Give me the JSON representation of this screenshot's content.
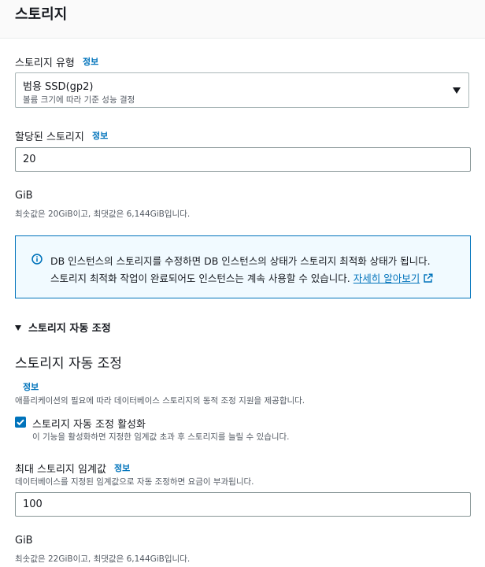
{
  "header": {
    "title": "스토리지"
  },
  "storage_type": {
    "label": "스토리지 유형",
    "info": "정보",
    "selected_value": "범용 SSD(gp2)",
    "selected_description": "볼륨 크기에 따라 기준 성능 결정"
  },
  "allocated_storage": {
    "label": "할당된 스토리지",
    "info": "정보",
    "value": "20",
    "unit": "GiB",
    "constraint": "최솟값은 20GiB이고, 최댓값은 6,144GiB입니다."
  },
  "alert": {
    "line1": "DB 인스턴스의 스토리지를 수정하면 DB 인스턴스의 상태가 스토리지 최적화 상태가 됩니다.",
    "line2": "스토리지 최적화 작업이 완료되어도 인스턴스는 계속 사용할 수 있습니다.",
    "link": "자세히 알아보기"
  },
  "autoscaling": {
    "expander_label": "스토리지 자동 조정",
    "title": "스토리지 자동 조정",
    "info": "정보",
    "description": "애플리케이션의 필요에 따라 데이터베이스 스토리지의 동적 조정 지원을 제공합니다.",
    "checkbox_label": "스토리지 자동 조정 활성화",
    "checkbox_checked": true,
    "checkbox_hint": "이 기능을 활성화하면 지정한 임계값 초과 후 스토리지를 늘릴 수 있습니다."
  },
  "max_threshold": {
    "label": "최대 스토리지 임계값",
    "info": "정보",
    "description": "데이터베이스를 지정된 임계값으로 자동 조정하면 요금이 부과됩니다.",
    "value": "100",
    "unit": "GiB",
    "constraint": "최솟값은 22GiB이고, 최댓값은 6,144GiB입니다."
  },
  "colors": {
    "accent": "#0073bb",
    "alert_bg": "#f1faff"
  },
  "icons": [
    "info-circle-icon",
    "external-link-icon",
    "caret-down-icon",
    "checkmark-icon"
  ]
}
